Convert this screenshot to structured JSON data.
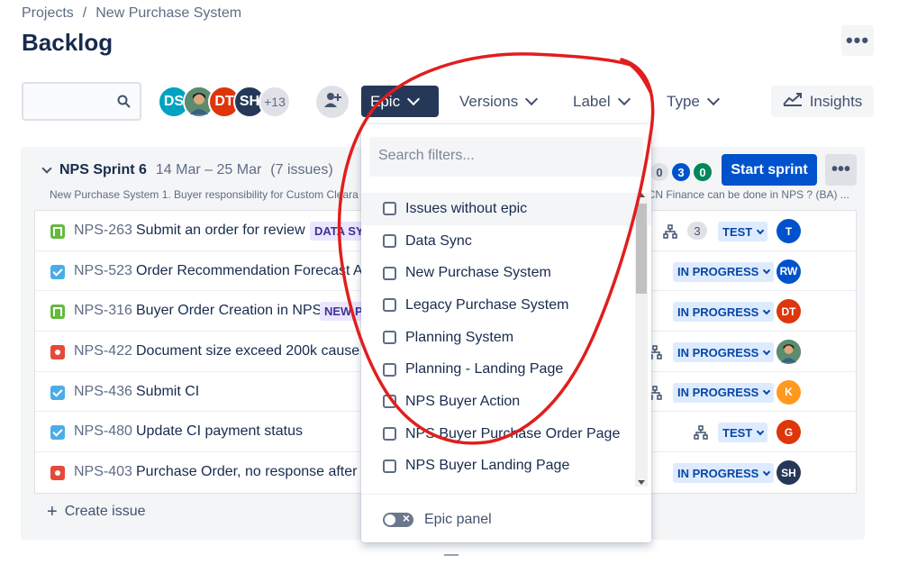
{
  "breadcrumb": {
    "root": "Projects",
    "separator": "/",
    "project": "New Purchase System"
  },
  "page": {
    "title": "Backlog",
    "more": "•••"
  },
  "toolbar": {
    "search_placeholder": "",
    "avatars": [
      {
        "initials": "DS",
        "color": "#00a3bf"
      },
      {
        "initials": "",
        "color": "#2f6b4f",
        "photo": true
      },
      {
        "initials": "DT",
        "color": "#de350b"
      },
      {
        "initials": "SH",
        "color": "#253858"
      },
      {
        "initials": "+13",
        "color": "#dfe1e6"
      }
    ],
    "filters": {
      "epic": "Epic",
      "versions": "Versions",
      "label": "Label",
      "type": "Type"
    },
    "insights": "Insights"
  },
  "sprint": {
    "name": "NPS Sprint 6",
    "dates": "14 Mar – 25 Mar",
    "count": "(7 issues)",
    "goal": "New Purchase System 1. Buyer responsibility for Custom Cleara",
    "goal_right": "s, CN Finance can be done in NPS ? (BA) ...",
    "status_counts": [
      {
        "value": "0",
        "bg": "#dfe1e6",
        "fg": "#42526e"
      },
      {
        "value": "3",
        "bg": "#0052cc",
        "fg": "#ffffff"
      },
      {
        "value": "0",
        "bg": "#00875a",
        "fg": "#ffffff"
      }
    ],
    "start_label": "Start sprint",
    "more": "•••"
  },
  "issues": [
    {
      "type": "story",
      "key": "NPS-263",
      "summary": "Submit an order for review",
      "epic": "DATA SYN",
      "points": "3",
      "status": "TEST",
      "assignee": "T",
      "assignee_color": "#0052cc"
    },
    {
      "type": "task",
      "key": "NPS-523",
      "summary": "Order Recommendation Forecast AP",
      "epic": "",
      "points": "",
      "status": "IN PROGRESS",
      "assignee": "RW",
      "assignee_color": "#0052cc"
    },
    {
      "type": "story",
      "key": "NPS-316",
      "summary": "Buyer Order Creation in NPS",
      "epic": "NEW P",
      "points": "",
      "status": "IN PROGRESS",
      "assignee": "DT",
      "assignee_color": "#de350b"
    },
    {
      "type": "bug",
      "key": "NPS-422",
      "summary": "Document size exceed 200k cause fa",
      "epic": "",
      "points": "",
      "status": "IN PROGRESS",
      "assignee": "",
      "assignee_color": "#2f6b4f"
    },
    {
      "type": "task",
      "key": "NPS-436",
      "summary": "Submit CI",
      "epic": "",
      "points": "",
      "status": "IN PROGRESS",
      "assignee": "K",
      "assignee_color": "#ff991f"
    },
    {
      "type": "task",
      "key": "NPS-480",
      "summary": "Update CI payment status",
      "epic": "",
      "points": "",
      "status": "TEST",
      "assignee": "G",
      "assignee_color": "#de350b"
    },
    {
      "type": "bug",
      "key": "NPS-403",
      "summary": "Purchase Order, no response after cl",
      "epic": "",
      "points": "",
      "status": "IN PROGRESS",
      "assignee": "SH",
      "assignee_color": "#253858"
    }
  ],
  "create_issue": {
    "plus": "+",
    "label": "Create issue"
  },
  "epic_dropdown": {
    "search_placeholder": "Search filters...",
    "options": [
      "Issues without epic",
      "Data Sync",
      "New Purchase System",
      "Legacy Purchase System",
      "Planning System",
      "Planning - Landing Page",
      "NPS Buyer Action",
      "NPS Buyer Purchase Order Page",
      "NPS Buyer Landing Page"
    ],
    "footer_label": "Epic panel"
  },
  "colors": {
    "primary": "#0052cc",
    "annotation": "#e01e1e",
    "status_bg": "#deebff"
  }
}
